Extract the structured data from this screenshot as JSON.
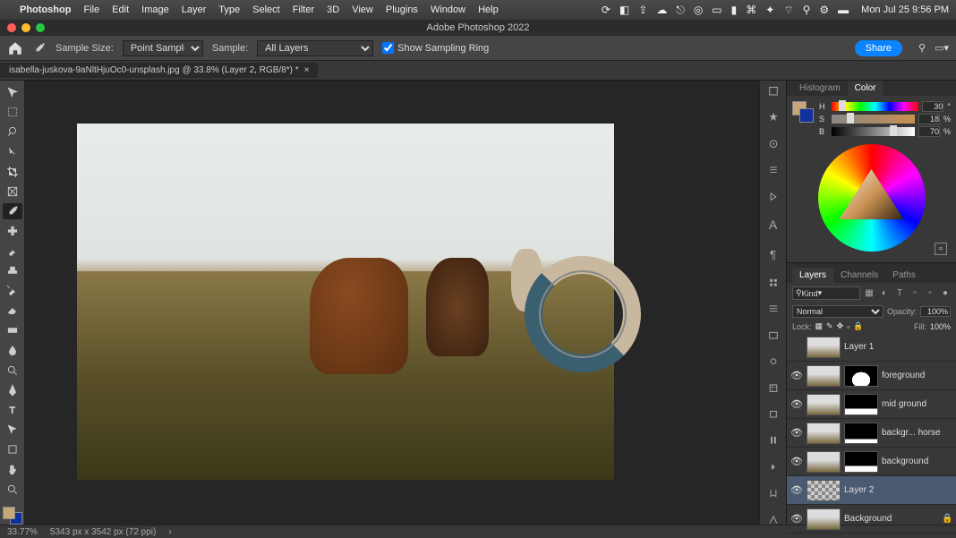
{
  "menubar": {
    "app": "Photoshop",
    "menus": [
      "File",
      "Edit",
      "Image",
      "Layer",
      "Type",
      "Select",
      "Filter",
      "3D",
      "View",
      "Plugins",
      "Window",
      "Help"
    ],
    "clock": "Mon Jul 25  9:56 PM"
  },
  "window": {
    "title": "Adobe Photoshop 2022"
  },
  "optionsbar": {
    "sample_size_label": "Sample Size:",
    "sample_size_value": "Point Sample",
    "sample_label": "Sample:",
    "sample_value": "All Layers",
    "show_ring_label": "Show Sampling Ring",
    "show_ring_checked": true,
    "share_label": "Share"
  },
  "doctab": {
    "label": "isabella-juskova-9aNltHjuOc0-unsplash.jpg @ 33.8% (Layer 2, RGB/8*) *"
  },
  "color": {
    "tabs": [
      "Histogram",
      "Color"
    ],
    "active_tab": "Color",
    "h": {
      "label": "H",
      "value": "30",
      "unit": "°"
    },
    "s": {
      "label": "S",
      "value": "18",
      "unit": "%"
    },
    "b": {
      "label": "B",
      "value": "70",
      "unit": "%"
    }
  },
  "layers_panel": {
    "tabs": [
      "Layers",
      "Channels",
      "Paths"
    ],
    "active_tab": "Layers",
    "filter_label": "Kind",
    "blend_mode": "Normal",
    "opacity_label": "Opacity:",
    "opacity_value": "100%",
    "lock_label": "Lock:",
    "fill_label": "Fill:",
    "fill_value": "100%",
    "layers": [
      {
        "name": "Layer 1",
        "visible": false,
        "mask": false,
        "selected": false,
        "locked": false
      },
      {
        "name": "foreground",
        "visible": true,
        "mask": true,
        "selected": false,
        "locked": false
      },
      {
        "name": "mid ground",
        "visible": true,
        "mask": true,
        "selected": false,
        "locked": false
      },
      {
        "name": "backgr... horse",
        "visible": true,
        "mask": true,
        "selected": false,
        "locked": false
      },
      {
        "name": "background",
        "visible": true,
        "mask": true,
        "selected": false,
        "locked": false
      },
      {
        "name": "Layer 2",
        "visible": true,
        "mask": false,
        "selected": true,
        "checker": true,
        "locked": false
      },
      {
        "name": "Background",
        "visible": true,
        "mask": false,
        "selected": false,
        "locked": true
      }
    ]
  },
  "statusbar": {
    "zoom": "33.77%",
    "dims": "5343 px x 3542 px (72 ppi)"
  },
  "tools": [
    "move-tool",
    "marquee-tool",
    "lasso-tool",
    "quick-select-tool",
    "crop-tool",
    "frame-tool",
    "eyedropper-tool",
    "healing-tool",
    "brush-tool",
    "stamp-tool",
    "history-brush-tool",
    "eraser-tool",
    "gradient-tool",
    "blur-tool",
    "dodge-tool",
    "pen-tool",
    "type-tool",
    "path-select-tool",
    "rectangle-tool",
    "hand-tool",
    "zoom-tool"
  ],
  "active_tool": "eyedropper-tool"
}
